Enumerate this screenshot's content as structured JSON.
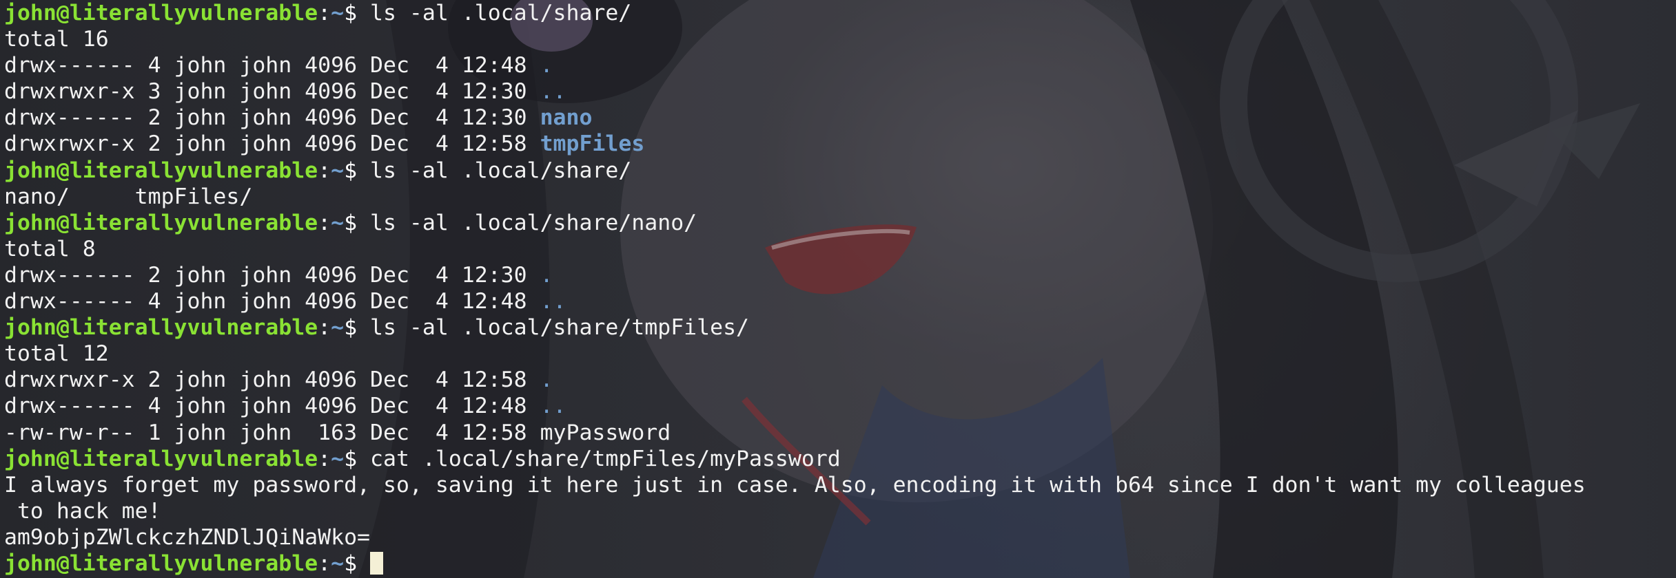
{
  "prompt": {
    "user_host": "john@literallyvulnerable",
    "separator": ":",
    "path": "~",
    "symbol": "$ "
  },
  "lines": [
    {
      "type": "prompt",
      "command": "ls -al .local/share/"
    },
    {
      "type": "text",
      "text": "total 16"
    },
    {
      "type": "ls",
      "prefix": "drwx------ 4 john john 4096 Dec  4 12:48 ",
      "name": ".",
      "style": "dot"
    },
    {
      "type": "ls",
      "prefix": "drwxrwxr-x 3 john john 4096 Dec  4 12:30 ",
      "name": "..",
      "style": "dot"
    },
    {
      "type": "ls",
      "prefix": "drwx------ 2 john john 4096 Dec  4 12:30 ",
      "name": "nano",
      "style": "dir"
    },
    {
      "type": "ls",
      "prefix": "drwxrwxr-x 2 john john 4096 Dec  4 12:58 ",
      "name": "tmpFiles",
      "style": "dir"
    },
    {
      "type": "prompt",
      "command": "ls -al .local/share/"
    },
    {
      "type": "text",
      "text": "nano/     tmpFiles/"
    },
    {
      "type": "prompt",
      "command": "ls -al .local/share/nano/"
    },
    {
      "type": "text",
      "text": "total 8"
    },
    {
      "type": "ls",
      "prefix": "drwx------ 2 john john 4096 Dec  4 12:30 ",
      "name": ".",
      "style": "dot"
    },
    {
      "type": "ls",
      "prefix": "drwx------ 4 john john 4096 Dec  4 12:48 ",
      "name": "..",
      "style": "dot"
    },
    {
      "type": "prompt",
      "command": "ls -al .local/share/tmpFiles/"
    },
    {
      "type": "text",
      "text": "total 12"
    },
    {
      "type": "ls",
      "prefix": "drwxrwxr-x 2 john john 4096 Dec  4 12:58 ",
      "name": ".",
      "style": "dot"
    },
    {
      "type": "ls",
      "prefix": "drwx------ 4 john john 4096 Dec  4 12:48 ",
      "name": "..",
      "style": "dot"
    },
    {
      "type": "ls",
      "prefix": "-rw-rw-r-- 1 john john  163 Dec  4 12:58 ",
      "name": "myPassword",
      "style": "file"
    },
    {
      "type": "prompt",
      "command": "cat .local/share/tmpFiles/myPassword"
    },
    {
      "type": "text",
      "text": "I always forget my password, so, saving it here just in case. Also, encoding it with b64 since I don't want my colleagues"
    },
    {
      "type": "text",
      "text": " to hack me!"
    },
    {
      "type": "text",
      "text": "am9objpZWlckczhZNDlJQiNaWko="
    },
    {
      "type": "prompt",
      "command": "",
      "cursor": true
    }
  ],
  "colors": {
    "prompt_user": "#8ae234",
    "prompt_path": "#729fcf",
    "directory": "#729fcf",
    "text": "#f2f2f2",
    "cursor": "#f4f0d6"
  }
}
